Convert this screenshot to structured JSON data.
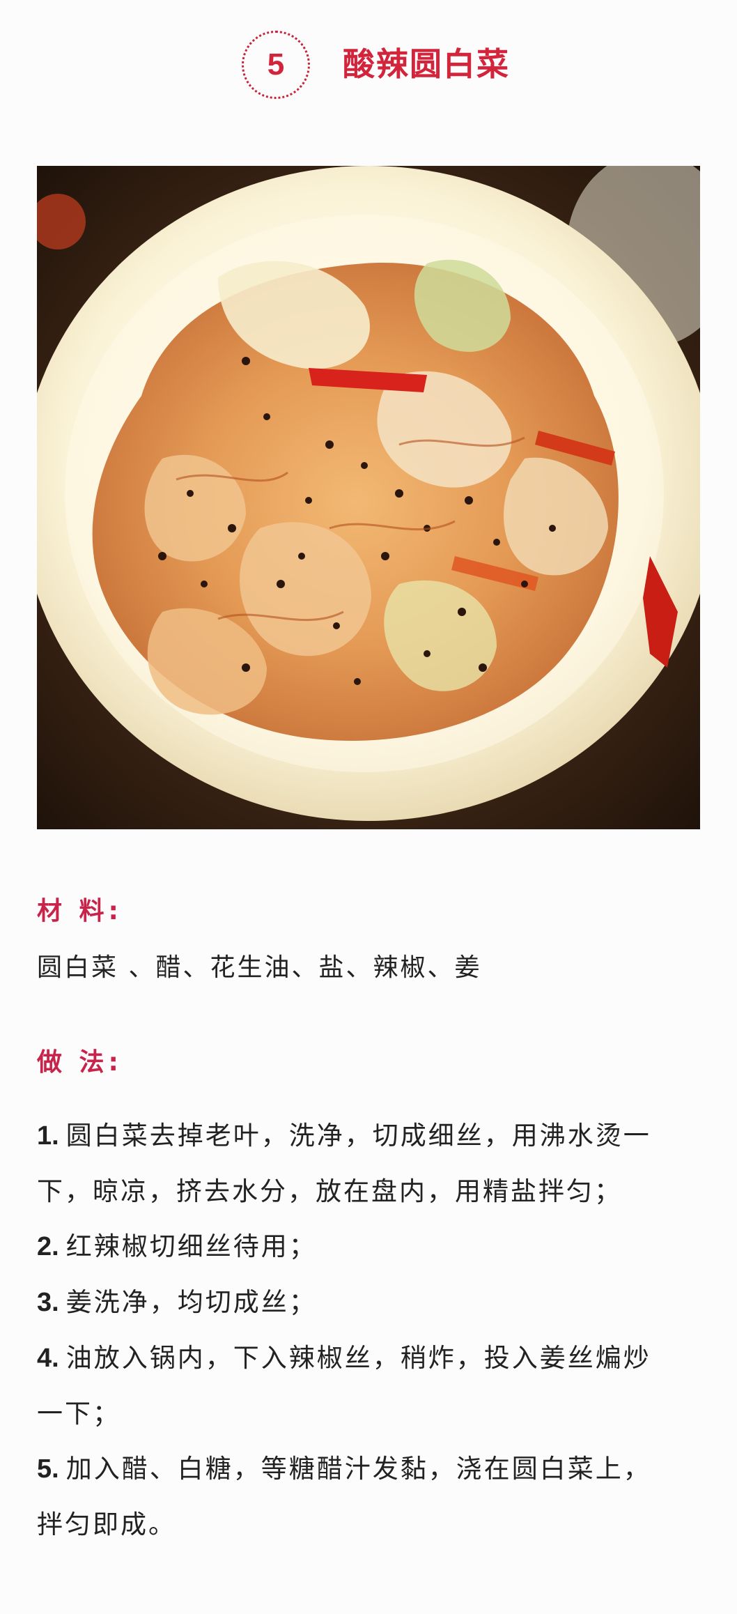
{
  "header": {
    "number": "5",
    "title": "酸辣圆白菜"
  },
  "photo": {
    "subject": "sour-spicy-cabbage-dish-photo"
  },
  "ingredients": {
    "heading": "材 料:",
    "text": "圆白菜 、醋、花生油、盐、辣椒、姜"
  },
  "method": {
    "heading": "做 法:",
    "steps": [
      {
        "num": "1.",
        "lines": [
          "圆白菜去掉老叶，洗净，切成细丝，用沸水烫一",
          "下，晾凉，挤去水分，放在盘内，用精盐拌匀；"
        ]
      },
      {
        "num": "2.",
        "lines": [
          "红辣椒切细丝待用；"
        ]
      },
      {
        "num": "3.",
        "lines": [
          "姜洗净，均切成丝；"
        ]
      },
      {
        "num": "4.",
        "lines": [
          "油放入锅内，下入辣椒丝，稍炸，投入姜丝煸炒",
          "一下；"
        ]
      },
      {
        "num": "5.",
        "lines": [
          "加入醋、白糖，等糖醋汁发黏，浇在圆白菜上，",
          "拌匀即成。"
        ]
      }
    ]
  },
  "colors": {
    "accent": "#d2253c",
    "heading": "#c8234a",
    "text": "#222222",
    "background": "#fcfcfc"
  }
}
